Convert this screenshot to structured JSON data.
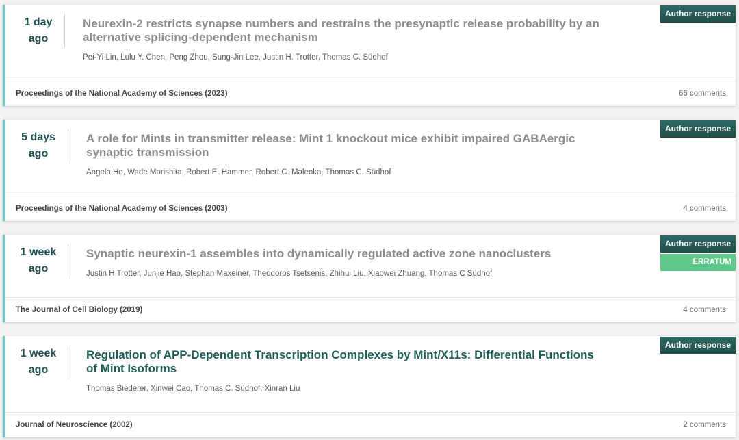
{
  "articles": [
    {
      "age_line1": "1 day",
      "age_line2": "ago",
      "title": "Neurexin-2 restricts synapse numbers and restrains the presynaptic release probability by an alternative splicing-dependent mechanism",
      "authors": "Pei-Yi Lin, Lulu Y. Chen, Peng Zhou, Sung-Jin Lee, Justin H. Trotter, Thomas C. Südhof",
      "journal": "Proceedings of the National Academy of Sciences (2023)",
      "comments": "66 comments",
      "badge": "Author response"
    },
    {
      "age_line1": "5 days",
      "age_line2": "ago",
      "title": "A role for Mints in transmitter release: Mint 1 knockout mice exhibit impaired GABAergic synaptic transmission",
      "authors": "Angela Ho, Wade Morishita, Robert E. Hammer, Robert C. Malenka, Thomas C. Südhof",
      "journal": "Proceedings of the National Academy of Sciences (2003)",
      "comments": "4 comments",
      "badge": "Author response"
    },
    {
      "age_line1": "1 week",
      "age_line2": "ago",
      "title": "Synaptic neurexin-1 assembles into dynamically regulated active zone nanoclusters",
      "authors": "Justin H Trotter, Junjie Hao, Stephan Maxeiner, Theodoros Tsetsenis, Zhihui Liu, Xiaowei Zhuang, Thomas C Südhof",
      "journal": "The Journal of Cell Biology (2019)",
      "comments": "4 comments",
      "badge": "Author response",
      "badge2": "ERRATUM"
    },
    {
      "age_line1": "1 week",
      "age_line2": "ago",
      "title": "Regulation of APP-Dependent Transcription Complexes by Mint/X11s: Differential Functions of Mint Isoforms",
      "authors": "Thomas Biederer, Xinwei Cao, Thomas C. Südhof, Xinran Liu",
      "journal": "Journal of Neuroscience (2002)",
      "comments": "2 comments",
      "badge": "Author response"
    }
  ],
  "colors": {
    "accent": "#79c3c0",
    "age_text": "#1e5250",
    "title_muted": "#8c8c8c",
    "title_active": "#1e5e56",
    "badge_author": "#24554f",
    "badge_erratum": "#5fc78a"
  }
}
